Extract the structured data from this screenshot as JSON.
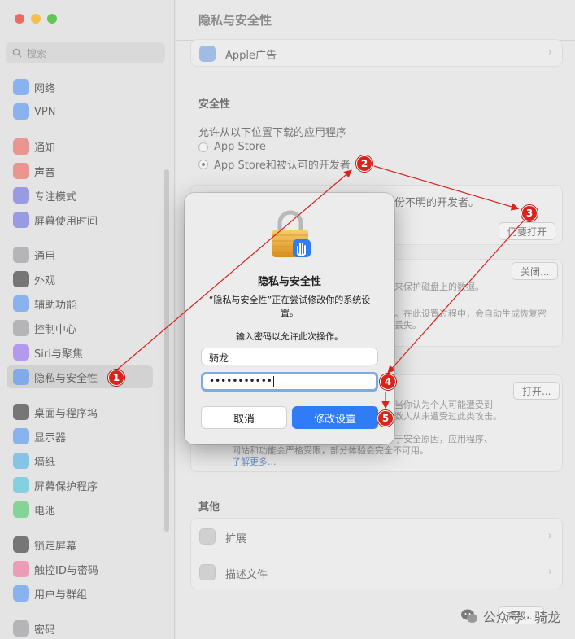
{
  "sidebar": {
    "search_placeholder": "搜索",
    "items": [
      {
        "label": "网络",
        "icon": "globe-icon",
        "color": "#3d8af7"
      },
      {
        "label": "VPN",
        "icon": "vpn-icon",
        "color": "#3d8af7"
      },
      {
        "label": "通知",
        "icon": "bell-icon",
        "color": "#f0544c"
      },
      {
        "label": "声音",
        "icon": "speaker-icon",
        "color": "#f0544c"
      },
      {
        "label": "专注模式",
        "icon": "moon-icon",
        "color": "#5b5fe0"
      },
      {
        "label": "屏幕使用时间",
        "icon": "hourglass-icon",
        "color": "#5b5fe0"
      },
      {
        "label": "通用",
        "icon": "gear-icon",
        "color": "#8e8e93"
      },
      {
        "label": "外观",
        "icon": "appearance-icon",
        "color": "#1c1c1e"
      },
      {
        "label": "辅助功能",
        "icon": "accessibility-icon",
        "color": "#3d8af7"
      },
      {
        "label": "控制中心",
        "icon": "switches-icon",
        "color": "#8e8e93"
      },
      {
        "label": "Siri与聚焦",
        "icon": "siri-icon",
        "color": "#8b5cf6"
      },
      {
        "label": "隐私与安全性",
        "icon": "hand-icon",
        "color": "#3d8af7"
      },
      {
        "label": "桌面与程序坞",
        "icon": "dock-icon",
        "color": "#1c1c1e"
      },
      {
        "label": "显示器",
        "icon": "sun-icon",
        "color": "#3d8af7"
      },
      {
        "label": "墙纸",
        "icon": "wallpaper-icon",
        "color": "#37a9e8"
      },
      {
        "label": "屏幕保护程序",
        "icon": "screensaver-icon",
        "color": "#37c0d8"
      },
      {
        "label": "电池",
        "icon": "battery-icon",
        "color": "#34c759"
      },
      {
        "label": "锁定屏幕",
        "icon": "lock-icon",
        "color": "#1c1c1e"
      },
      {
        "label": "触控ID与密码",
        "icon": "fingerprint-icon",
        "color": "#f06292"
      },
      {
        "label": "用户与群组",
        "icon": "users-icon",
        "color": "#3d8af7"
      },
      {
        "label": "密码",
        "icon": "key-icon",
        "color": "#8e8e93"
      }
    ]
  },
  "main": {
    "title": "隐私与安全性",
    "apple_ads": "Apple广告",
    "security_heading": "安全性",
    "allow_label": "允许从以下位置下载的应用程序",
    "radio_app_store": "App Store",
    "radio_identified": "App Store和被认可的开发者",
    "unknown_dev_text": "份不明的开发者。",
    "open_anyway": "仍要打开",
    "filevault_btn": "关闭...",
    "filevault_text1": "来保护磁盘上的数据。",
    "filevault_text2": "。在此设置过程中，会自动生成恢复密",
    "filevault_text3": "丢失。",
    "lockdown_btn": "打开...",
    "lockdown_text1": "当你认为个人可能遭受到",
    "lockdown_text2": "数人从未遭受过此类攻击。",
    "lockdown_text3": "于安全原因，应用程序、",
    "lockdown_text4": "网站和功能会严格受限，部分体验会完全不可用。",
    "learn_more": "了解更多...",
    "others_heading": "其他",
    "extensions": "扩展",
    "profiles": "描述文件",
    "advanced": "高级..."
  },
  "dialog": {
    "title": "隐私与安全性",
    "message": "“隐私与安全性”正在尝试修改你的系统设置。",
    "prompt": "输入密码以允许此次操作。",
    "username": "骑龙",
    "password_mask": "•••••••••••",
    "cancel": "取消",
    "confirm": "修改设置"
  },
  "annotations": {
    "badge_1": "1",
    "badge_2": "2",
    "badge_3": "3",
    "badge_4": "4",
    "badge_5": "5",
    "color": "#d9231c"
  },
  "watermark": {
    "text": "公众号 · 骑龙"
  }
}
